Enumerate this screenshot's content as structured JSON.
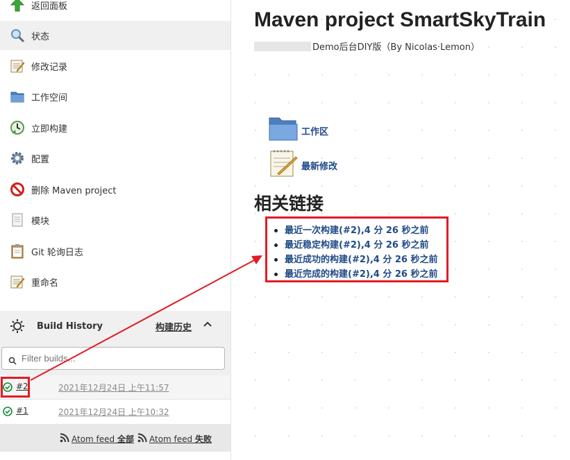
{
  "sidebar": {
    "tasks": [
      {
        "label": "返回面板",
        "icon": "up-arrow-icon"
      },
      {
        "label": "状态",
        "icon": "magnifier-icon"
      },
      {
        "label": "修改记录",
        "icon": "notepad-icon"
      },
      {
        "label": "工作空间",
        "icon": "folder-icon"
      },
      {
        "label": "立即构建",
        "icon": "build-now-icon"
      },
      {
        "label": "配置",
        "icon": "gear-icon"
      },
      {
        "label": "删除 Maven project",
        "icon": "no-entry-icon"
      },
      {
        "label": "模块",
        "icon": "document-icon"
      },
      {
        "label": "Git 轮询日志",
        "icon": "clipboard-icon"
      },
      {
        "label": "重命名",
        "icon": "notepad-icon"
      }
    ]
  },
  "build_history": {
    "title": "Build History",
    "trend_label": "构建历史",
    "filter_placeholder": "Filter builds...",
    "builds": [
      {
        "number": "#2",
        "time": "2021年12月24日 上午11:57",
        "status": "success"
      },
      {
        "number": "#1",
        "time": "2021年12月24日 上午10:32",
        "status": "success"
      }
    ],
    "feeds": [
      {
        "prefix": "Atom feed ",
        "suffix": "全部"
      },
      {
        "prefix": "Atom feed ",
        "suffix": "失败"
      }
    ]
  },
  "main": {
    "title": "Maven project SmartSkyTrain",
    "subtitle": "Demo后台DIY版（By Nicolas·Lemon）",
    "workspace_label": "工作区",
    "changes_label": "最新修改",
    "section_title": "相关链接",
    "permalinks": [
      {
        "text": "最近一次构建(#2),4 分 26 秒之前"
      },
      {
        "text": "最近稳定构建(#2),4 分 26 秒之前"
      },
      {
        "text": "最近成功的构建(#2),4 分 26 秒之前"
      },
      {
        "text": "最近完成的构建(#2),4 分 26 秒之前"
      }
    ]
  },
  "colors": {
    "annotation_red": "#e21b24",
    "link_blue": "#204a87",
    "success_green": "#138a36"
  }
}
